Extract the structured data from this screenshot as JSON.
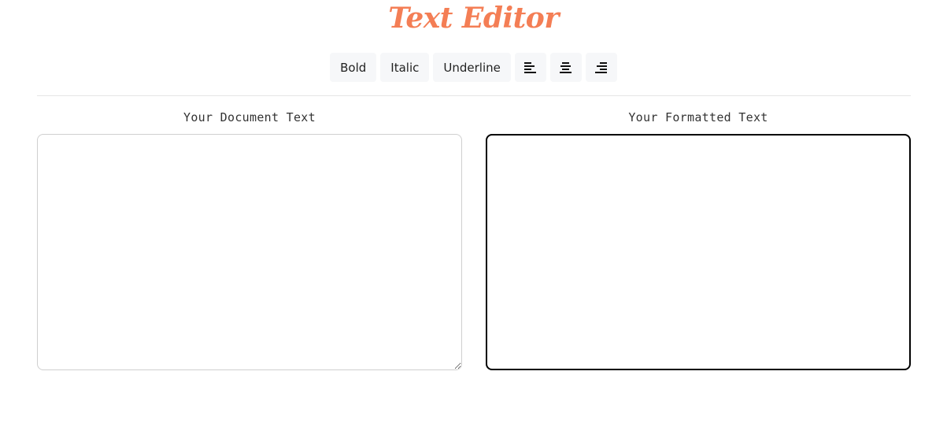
{
  "app": {
    "title": "Text Editor"
  },
  "toolbar": {
    "bold_label": "Bold",
    "italic_label": "Italic",
    "underline_label": "Underline",
    "align_left_icon": "align-left-icon",
    "align_center_icon": "align-center-icon",
    "align_right_icon": "align-right-icon"
  },
  "editor": {
    "input_label": "Your Document Text",
    "input_value": "",
    "output_label": "Your Formatted Text",
    "output_value": ""
  }
}
